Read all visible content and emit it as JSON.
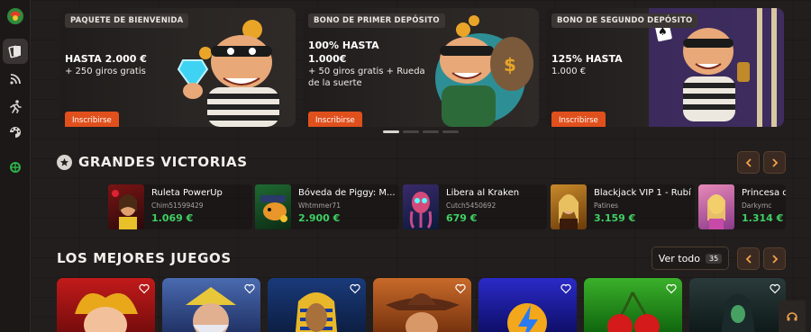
{
  "banners": [
    {
      "tag": "PAQUETE DE BIENVENIDA",
      "title": "HASTA 2.000 €",
      "subtitle": "+ 250 giros gratis",
      "cta": "Inscribirse"
    },
    {
      "tag": "BONO DE PRIMER DEPÓSITO",
      "title": "100% HASTA\n1.000€",
      "subtitle": "+ 50 giros gratis + Rueda\nde la suerte",
      "cta": "Inscribirse"
    },
    {
      "tag": "BONO DE SEGUNDO DEPÓSITO",
      "title": "125% HASTA",
      "subtitle": "1.000 €",
      "cta": "Inscribirse"
    }
  ],
  "big_wins": {
    "title": "GRANDES VICTORIAS",
    "items": [
      {
        "game": "Ruleta PowerUp",
        "user": "Chim51599429",
        "amount": "1.069 €"
      },
      {
        "game": "Bóveda de Piggy: M...",
        "user": "Whtmmer71",
        "amount": "2.900 €"
      },
      {
        "game": "Libera al Kraken",
        "user": "Cutch5450692",
        "amount": "679 €"
      },
      {
        "game": "Blackjack VIP 1 - Rubí",
        "user": "Patines",
        "amount": "3.159 €"
      },
      {
        "game": "Princesa d",
        "user": "Darkymc",
        "amount": "1.314 €"
      }
    ]
  },
  "top_games": {
    "title": "LOS MEJORES JUEGOS",
    "view_all": "Ver todo",
    "count": "35"
  },
  "icons": [
    "logo-icon",
    "cards-icon",
    "live-icon",
    "sports-icon",
    "virtual-icon",
    "promo-icon"
  ],
  "colors": {
    "accent": "#e0501d",
    "win_green": "#3fd063",
    "background": "#221e1d"
  }
}
